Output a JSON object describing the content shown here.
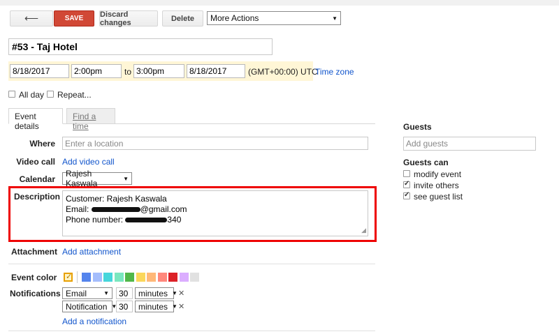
{
  "toolbar": {
    "back_icon": "back-arrow-icon",
    "back_glyph": "⟵",
    "save_label": "SAVE",
    "discard_label": "Discard changes",
    "delete_label": "Delete",
    "more_actions_label": "More Actions"
  },
  "event": {
    "title": "#53 - Taj Hotel",
    "start_date": "8/18/2017",
    "start_time": "2:00pm",
    "to_label": "to",
    "end_time": "3:00pm",
    "end_date": "8/18/2017",
    "timezone_label": "(GMT+00:00) UTC",
    "timezone_link": "Time zone",
    "all_day_label": "All day",
    "repeat_label": "Repeat..."
  },
  "tabs": [
    {
      "label": "Event details"
    },
    {
      "label": "Find a time"
    }
  ],
  "details": {
    "where_label": "Where",
    "where_placeholder": "Enter a location",
    "video_label": "Video call",
    "video_link": "Add video call",
    "calendar_label": "Calendar",
    "calendar_value": "Rajesh Kaswala",
    "description_label": "Description",
    "description_line1": "Customer: Rajesh Kaswala",
    "description_email_prefix": "Email:",
    "description_email_suffix": "@gmail.com",
    "description_phone_prefix": "Phone number:",
    "description_phone_suffix": "340",
    "attachment_label": "Attachment",
    "attachment_link": "Add attachment",
    "event_color_label": "Event color",
    "notifications_label": "Notifications",
    "notif1_type": "Email",
    "notif1_value": "30",
    "notif1_unit": "minutes",
    "notif2_type": "Notification",
    "notif2_value": "30",
    "notif2_unit": "minutes",
    "remove_glyph": "✕",
    "add_notification_link": "Add a notification"
  },
  "colors": [
    "#f7c34b",
    "#5484ed",
    "#a4bdfc",
    "#46d6db",
    "#7ae7bf",
    "#51b749",
    "#fbd75b",
    "#ffb878",
    "#ff887c",
    "#dc2127",
    "#dbadff",
    "#e1e1e1"
  ],
  "guests": {
    "title": "Guests",
    "add_placeholder": "Add guests",
    "can_title": "Guests can",
    "permissions": [
      {
        "label": "modify event",
        "checked": false
      },
      {
        "label": "invite others",
        "checked": true
      },
      {
        "label": "see guest list",
        "checked": true
      }
    ]
  }
}
